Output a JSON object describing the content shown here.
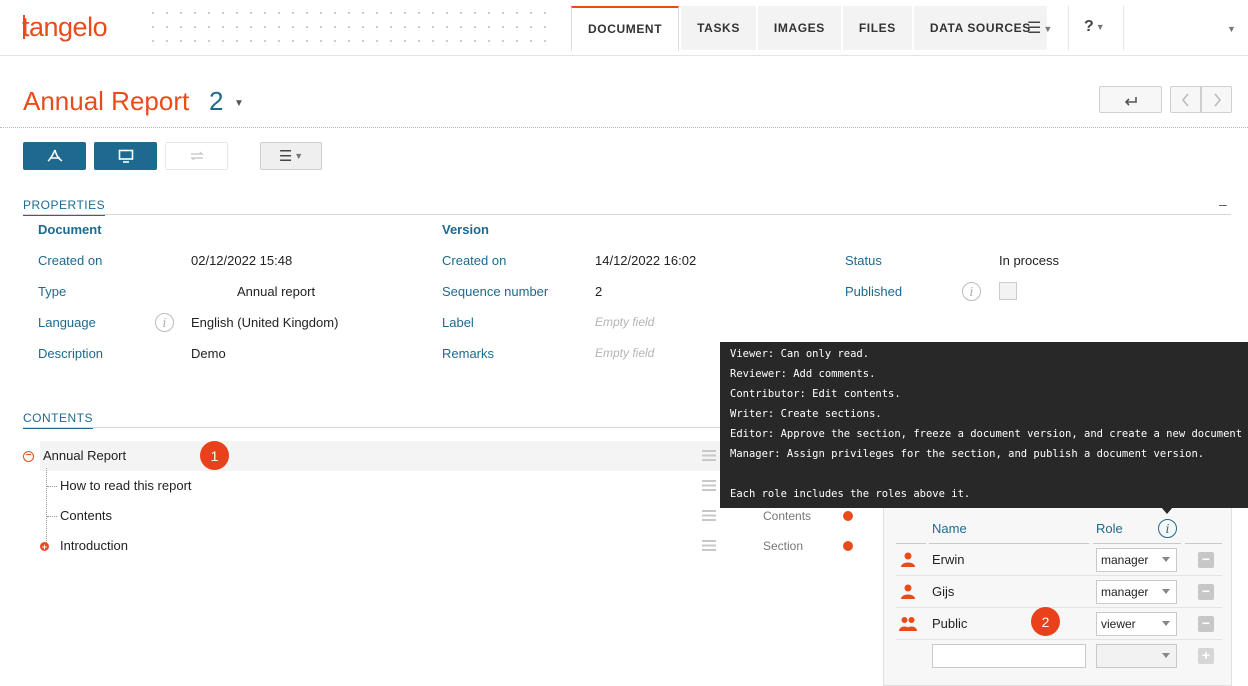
{
  "app": {
    "logo": "tangelo"
  },
  "nav": {
    "tabs": [
      {
        "label": "DOCUMENT",
        "active": true
      },
      {
        "label": "TASKS"
      },
      {
        "label": "IMAGES"
      },
      {
        "label": "FILES"
      },
      {
        "label": "DATA SOURCES"
      }
    ],
    "menu_icon": "hamburger-menu-icon",
    "help_label": "?"
  },
  "header": {
    "title": "Annual Report",
    "version": "2",
    "back_icon": "return-arrow-icon"
  },
  "toolbar": {
    "pdf_icon": "pdf-icon",
    "preview_icon": "monitor-icon",
    "compare_icon": "compare-arrows-icon",
    "menu_icon": "hamburger-menu-icon"
  },
  "properties": {
    "heading": "PROPERTIES",
    "collapse": "–",
    "document": {
      "heading": "Document",
      "created_on_label": "Created on",
      "created_on": "02/12/2022 15:48",
      "type_label": "Type",
      "type": "Annual report",
      "language_label": "Language",
      "language": "English (United Kingdom)",
      "description_label": "Description",
      "description": "Demo"
    },
    "version": {
      "heading": "Version",
      "created_on_label": "Created on",
      "created_on": "14/12/2022 16:02",
      "sequence_label": "Sequence number",
      "sequence": "2",
      "label_label": "Label",
      "label": "Empty field",
      "remarks_label": "Remarks",
      "remarks": "Empty field"
    },
    "status": {
      "status_label": "Status",
      "status": "In process",
      "published_label": "Published",
      "published": false
    }
  },
  "contents": {
    "heading": "CONTENTS",
    "items": [
      {
        "label": "Annual Report"
      },
      {
        "label": "How to read this report"
      },
      {
        "label": "Contents",
        "type": "Contents"
      },
      {
        "label": "Introduction",
        "type": "Section"
      }
    ]
  },
  "badges": {
    "one": "1",
    "two": "2"
  },
  "privileges": {
    "name_header": "Name",
    "role_header": "Role",
    "rows": [
      {
        "name": "Erwin",
        "role": "manager"
      },
      {
        "name": "Gijs",
        "role": "manager"
      },
      {
        "name": "Public",
        "role": "viewer"
      }
    ],
    "remove_label": "−",
    "add_label": "+"
  },
  "tooltip": {
    "lines": [
      "Viewer: Can only read.",
      "Reviewer: Add comments.",
      "Contributor: Edit contents.",
      "Writer: Create sections.",
      "Editor: Approve the section, freeze a document version, and create a new document version.",
      "Manager: Assign privileges for the section, and publish a document version.",
      "",
      "Each role includes the roles above it."
    ]
  },
  "colors": {
    "brand": "#ea4b1b",
    "accent": "#1d6a8e",
    "tooltip_bg": "#282828"
  }
}
